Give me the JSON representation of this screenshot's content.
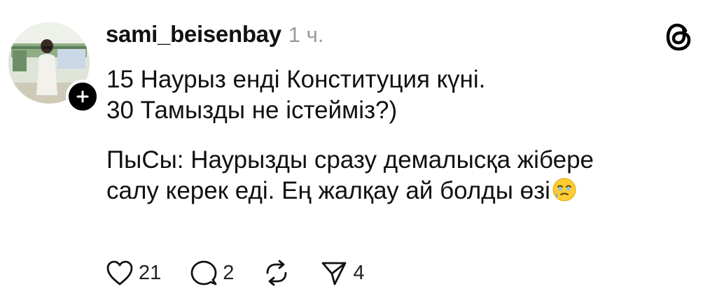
{
  "post": {
    "author": {
      "username": "sami_beisenbay",
      "timestamp": "1 ч."
    },
    "lines": [
      "15 Наурыз енді Конституция күні.",
      "30 Тамызды не істейміз?)",
      "ПыСы: Наурызды сразу демалысқа жібере",
      "салу керек еді. Ең жалқау ай болды өзі"
    ],
    "trailing_emoji": "face-holding-back-tears-emoji"
  },
  "actions": {
    "likes": "21",
    "comments": "2",
    "shares": "4"
  },
  "icons": {
    "like": "heart-icon",
    "comment": "comment-bubble-icon",
    "repost": "repost-icon",
    "share": "send-icon",
    "app": "threads-logo-icon",
    "follow": "plus-icon"
  },
  "colors": {
    "text": "#111111",
    "muted": "#9a9a9a",
    "background": "#ffffff"
  }
}
